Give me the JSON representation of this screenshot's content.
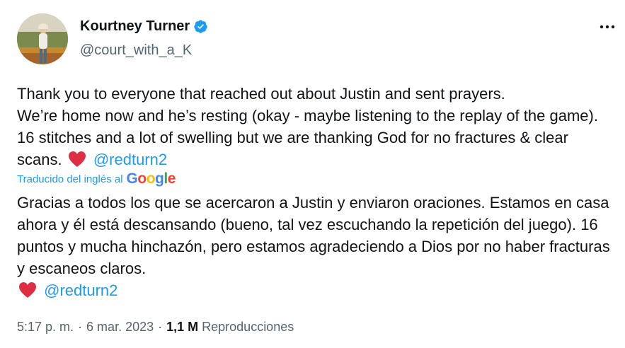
{
  "author": {
    "name": "Kourtney Turner",
    "handle": "@court_with_a_K",
    "verified": true
  },
  "more_icon": "more-horizontal-icon",
  "tweet": {
    "text": "Thank you to everyone that reached out about Justin and sent prayers.\nWe’re home now and he’s resting (okay - maybe listening to the replay of the game).  16 stitches and a lot of swelling but we are thanking God for no fractures & clear scans. ",
    "mention": "@redturn2",
    "emoji": "red-heart-icon"
  },
  "translation": {
    "label": "Traducido del inglés al",
    "provider": "Google",
    "text": "Gracias a todos los que se acercaron a Justin y enviaron oraciones. Estamos en casa ahora y él está descansando (bueno, tal vez escuchando la repetición del juego). 16 puntos y mucha hinchazón, pero estamos agradeciendo a Dios por no haber fracturas y escaneos claros.",
    "mention": "@redturn2"
  },
  "meta": {
    "time": "5:17 p. m.",
    "date": "6 mar. 2023",
    "views_count": "1,1 M",
    "views_label": "Reproducciones"
  },
  "colors": {
    "accent": "#1d9bf0",
    "text": "#0f1419",
    "secondary": "#536471",
    "heart": "#f91880"
  }
}
